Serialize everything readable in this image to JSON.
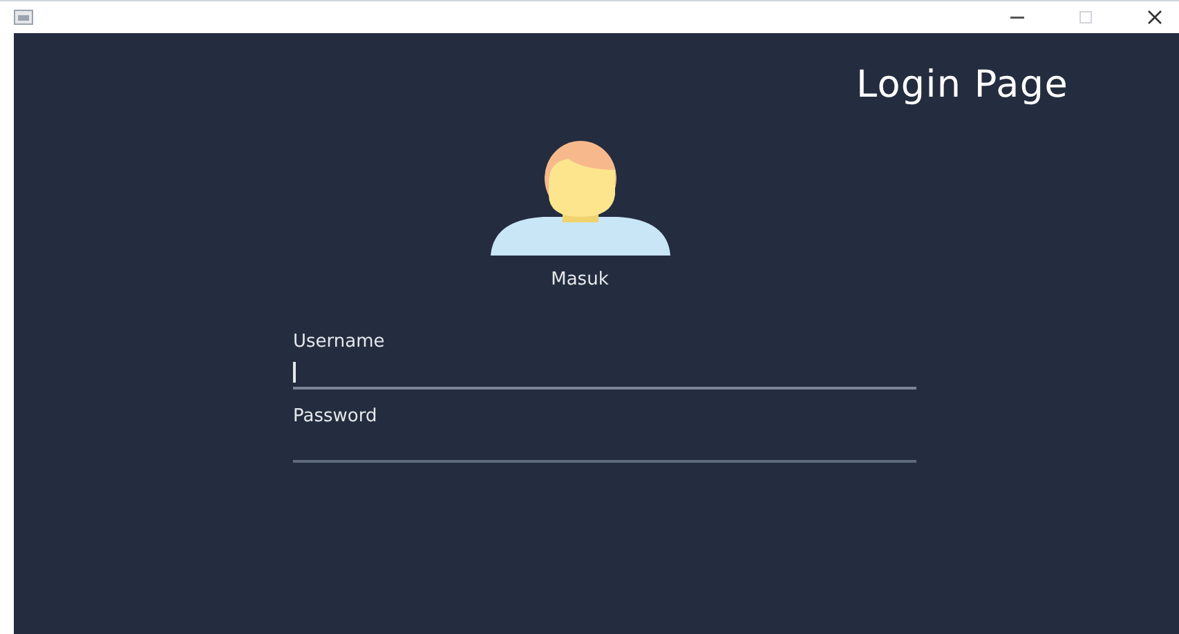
{
  "window": {
    "maximize_disabled": true
  },
  "header": {
    "title": "Login Page"
  },
  "avatar": {
    "caption": "Masuk"
  },
  "fields": [
    {
      "label": "Username",
      "focused": true
    },
    {
      "label": "Password",
      "focused": false
    }
  ]
}
